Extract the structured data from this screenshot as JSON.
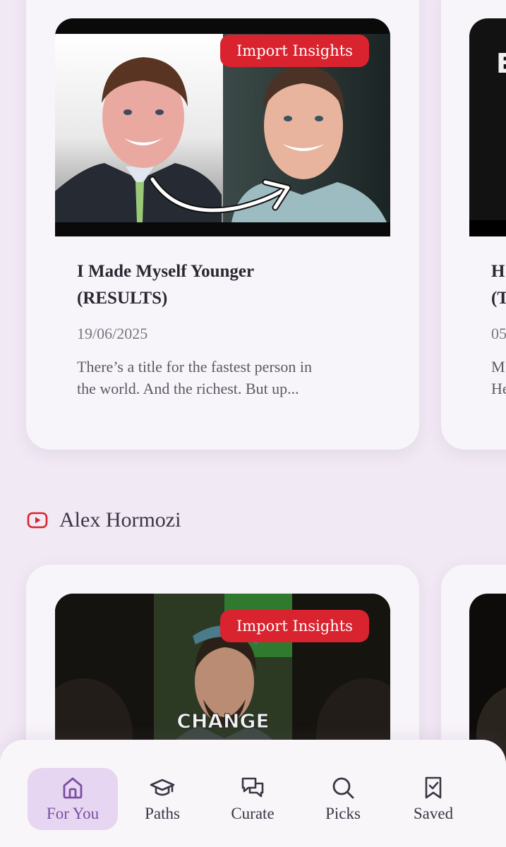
{
  "cards": [
    {
      "badge": "Import Insights",
      "title_line1": "I Made Myself Younger",
      "title_line2": "(RESULTS)",
      "date": "19/06/2025",
      "desc_line1": "There’s a title for the fastest person in",
      "desc_line2": "the world. And the richest. But up..."
    }
  ],
  "peek_card": {
    "thumb_letter": "E",
    "title_line1": "H",
    "title_line2": "(T",
    "date": "05",
    "desc_line1": "M",
    "desc_line2": "He"
  },
  "section": {
    "icon": "youtube-icon",
    "title": "Alex Hormozi"
  },
  "card2": {
    "badge": "Import Insights",
    "thumb_caption": "CHANGE"
  },
  "nav": {
    "items": [
      {
        "label": "For You",
        "icon": "home-icon",
        "active": true
      },
      {
        "label": "Paths",
        "icon": "graduation-cap-icon",
        "active": false
      },
      {
        "label": "Curate",
        "icon": "chat-bubbles-icon",
        "active": false
      },
      {
        "label": "Picks",
        "icon": "search-icon",
        "active": false
      },
      {
        "label": "Saved",
        "icon": "bookmark-check-icon",
        "active": false
      }
    ]
  },
  "colors": {
    "background": "#f1e9f4",
    "card": "#f8f5fa",
    "badge": "#d9232f",
    "accent": "#7c4ea3",
    "active_tab_bg": "#e7d6f1"
  }
}
